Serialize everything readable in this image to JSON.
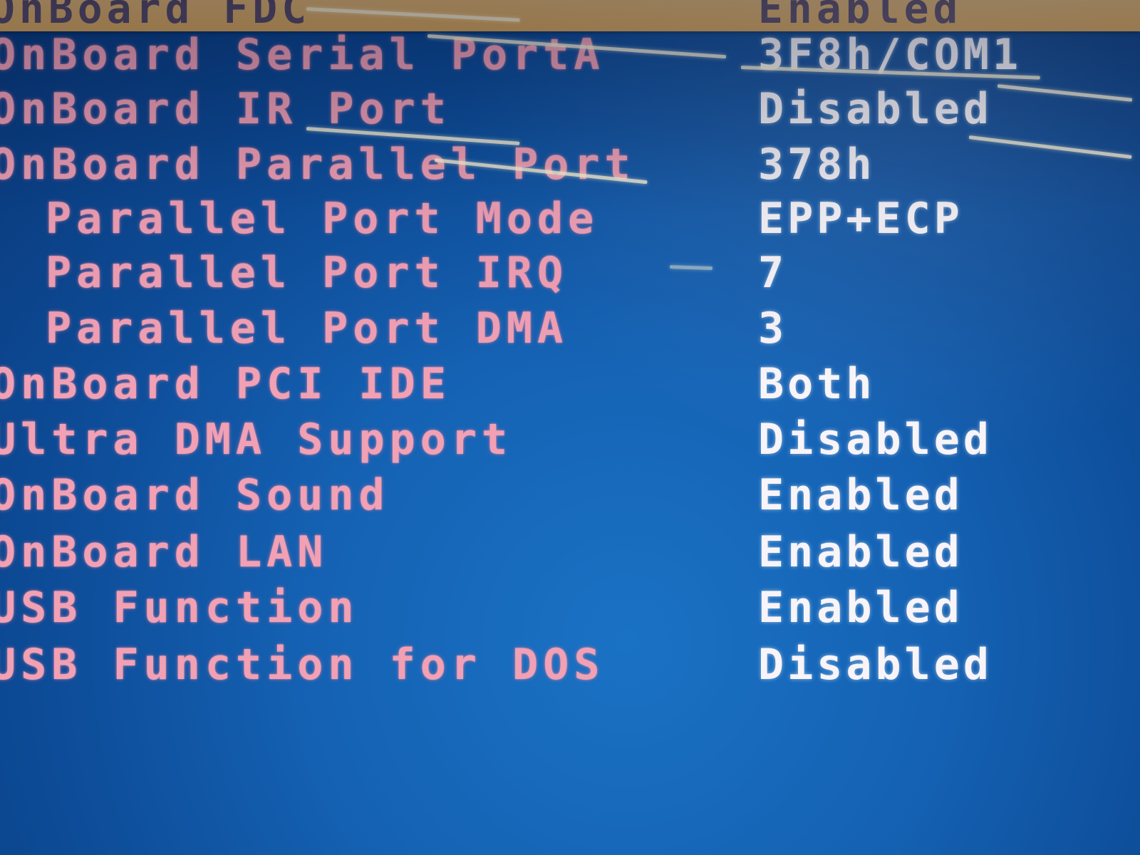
{
  "colors": {
    "background": "#1562b4",
    "label": "#f2a0b4",
    "value": "#f8f4f8",
    "highlight": "#d9a558"
  },
  "highlighted_row": {
    "label": "OnBoard FDC",
    "value": "Enabled"
  },
  "settings": [
    {
      "label": "OnBoard Serial PortA",
      "value": "3F8h/COM1"
    },
    {
      "label": "OnBoard IR Port",
      "value": "Disabled"
    },
    {
      "label": "OnBoard Parallel Port",
      "value": "378h"
    },
    {
      "label": "Parallel Port Mode",
      "value": "EPP+ECP"
    },
    {
      "label": "Parallel Port IRQ",
      "value": "7"
    },
    {
      "label": "Parallel Port DMA",
      "value": "3"
    },
    {
      "label": "OnBoard PCI IDE",
      "value": "Both"
    },
    {
      "label": "Ultra DMA Support",
      "value": "Disabled"
    },
    {
      "label": "OnBoard Sound",
      "value": "Enabled"
    },
    {
      "label": "OnBoard LAN",
      "value": "Enabled"
    },
    {
      "label": "USB Function",
      "value": "Enabled"
    },
    {
      "label": "USB Function for DOS",
      "value": "Disabled"
    }
  ]
}
